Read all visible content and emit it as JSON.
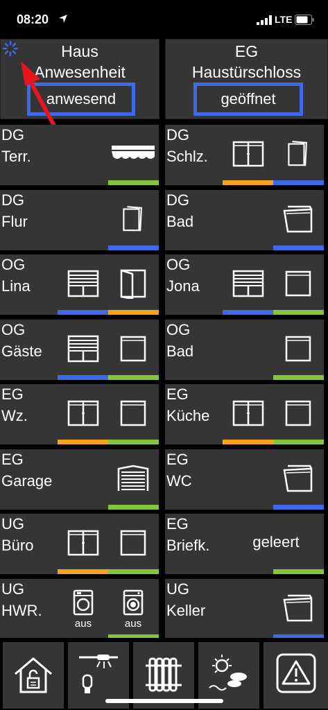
{
  "status_bar": {
    "time": "08:20",
    "network": "LTE"
  },
  "header": [
    {
      "line1": "Haus",
      "line2": "Anwesenheit",
      "status": "anwesend"
    },
    {
      "line1": "EG",
      "line2": "Haustürschloss",
      "status": "geöffnet"
    }
  ],
  "tiles": [
    {
      "line1": "DG",
      "line2": "Terr.",
      "icons": [
        "awning-icon"
      ],
      "bar": [
        "green"
      ]
    },
    {
      "line1": "DG",
      "line2": "Schlz.",
      "icons": [
        "window-double-icon",
        "window-tilted-icon"
      ],
      "bar": [
        "orange",
        "blue"
      ]
    },
    {
      "line1": "DG",
      "line2": "Flur",
      "icons": [
        "window-tilted-icon"
      ],
      "bar": [
        "blue"
      ]
    },
    {
      "line1": "DG",
      "line2": "Bad",
      "icons": [
        "window-skylight-icon"
      ],
      "bar": [
        "blue"
      ]
    },
    {
      "line1": "OG",
      "line2": "Lina",
      "icons": [
        "shutter-window-icon",
        "door-open-icon"
      ],
      "bar": [
        "blue",
        "orange"
      ]
    },
    {
      "line1": "OG",
      "line2": "Jona",
      "icons": [
        "shutter-window-icon",
        "window-single-icon"
      ],
      "bar": [
        "blue",
        "green"
      ]
    },
    {
      "line1": "OG",
      "line2": "Gäste",
      "icons": [
        "shutter-window-icon",
        "window-single-icon"
      ],
      "bar": [
        "blue",
        "green"
      ]
    },
    {
      "line1": "OG",
      "line2": "Bad",
      "icons": [
        "window-single-icon"
      ],
      "bar": [
        "green"
      ]
    },
    {
      "line1": "EG",
      "line2": "Wz.",
      "icons": [
        "window-double-icon",
        "window-single-icon"
      ],
      "bar": [
        "orange",
        "green"
      ]
    },
    {
      "line1": "EG",
      "line2": "Küche",
      "icons": [
        "window-double-icon",
        "window-single-icon"
      ],
      "bar": [
        "orange",
        "green"
      ]
    },
    {
      "line1": "EG",
      "line2": "Garage",
      "icons": [
        "garage-door-icon"
      ],
      "bar": [
        "green"
      ]
    },
    {
      "line1": "EG",
      "line2": "WC",
      "icons": [
        "window-skylight-icon"
      ],
      "bar": [
        "blue"
      ]
    },
    {
      "line1": "UG",
      "line2": "Büro",
      "icons": [
        "window-double-icon",
        "window-single-icon"
      ],
      "bar": [
        "orange",
        "green"
      ]
    },
    {
      "line1": "EG",
      "line2": "Briefk.",
      "text": "geleert",
      "bar": [
        "green"
      ]
    },
    {
      "line1": "UG",
      "line2": "HWR.",
      "icons": [
        "dryer-icon",
        "washing-machine-icon"
      ],
      "labels": [
        "aus",
        "aus"
      ],
      "bar": [
        "green"
      ]
    },
    {
      "line1": "UG",
      "line2": "Keller",
      "icons": [
        "window-skylight-icon"
      ],
      "bar": [
        "blue"
      ]
    }
  ],
  "colors": {
    "green": "#86c33f",
    "orange": "#f5a21e",
    "blue": "#3d6be5",
    "status_border": "#3d6be5",
    "annotation_arrow": "#e8141c"
  },
  "nav": [
    {
      "icon": "home-lock-icon"
    },
    {
      "icon": "lights-icon"
    },
    {
      "icon": "radiator-icon"
    },
    {
      "icon": "weather-icon"
    },
    {
      "icon": "warning-icon"
    }
  ]
}
